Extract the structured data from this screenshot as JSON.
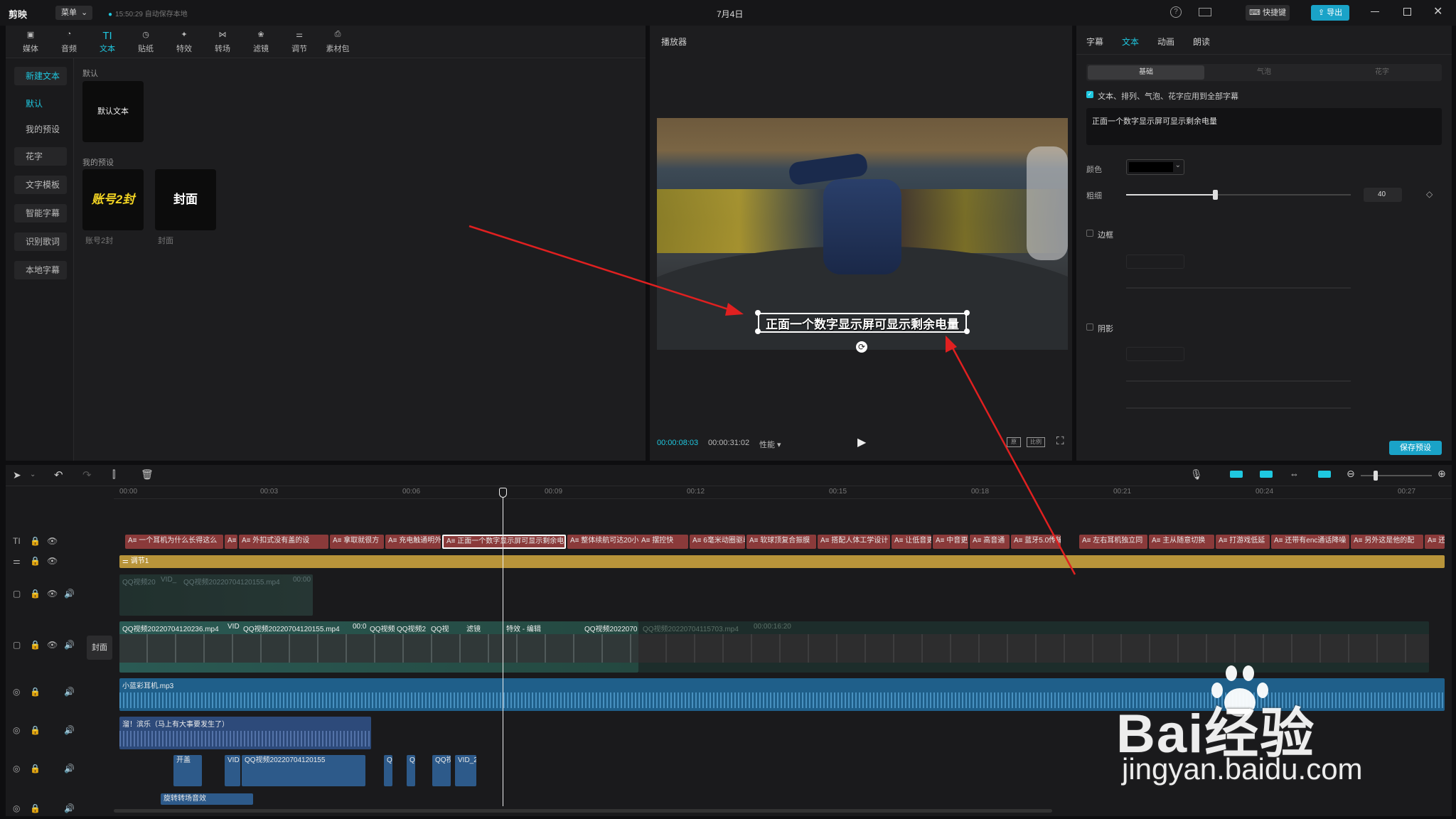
{
  "titlebar": {
    "app_name": "剪映",
    "menu_label": "菜单",
    "autosave": "15:50:29 自动保存本地",
    "project_title": "7月4日",
    "shortcut_label": "快捷键",
    "export_label": "导出"
  },
  "toolbar": [
    {
      "label": "媒体"
    },
    {
      "label": "音频"
    },
    {
      "label": "文本"
    },
    {
      "label": "贴纸"
    },
    {
      "label": "特效"
    },
    {
      "label": "转场"
    },
    {
      "label": "滤镜"
    },
    {
      "label": "调节"
    },
    {
      "label": "素材包"
    }
  ],
  "sidebar": [
    {
      "label": "新建文本"
    },
    {
      "label": "默认"
    },
    {
      "label": "我的预设"
    },
    {
      "label": "花字"
    },
    {
      "label": "文字模板"
    },
    {
      "label": "智能字幕"
    },
    {
      "label": "识别歌词"
    },
    {
      "label": "本地字幕"
    }
  ],
  "library": {
    "default_section": "默认",
    "default_card": "默认文本",
    "preset_section": "我的预设",
    "preset1_text": "账号2封",
    "preset1_caption": "账号2封",
    "preset2_text": "封面",
    "preset2_caption": "封面"
  },
  "player": {
    "title": "播放器",
    "subtitle": "正面一个数字显示屏可显示剩余电量",
    "current_time": "00:00:08:03",
    "total_time": "00:00:31:02",
    "mode": "性能",
    "btn_a": "原",
    "btn_b": "比例"
  },
  "inspector": {
    "tabs": [
      {
        "label": "字幕"
      },
      {
        "label": "文本"
      },
      {
        "label": "动画"
      },
      {
        "label": "朗读"
      }
    ],
    "subtabs": [
      {
        "label": "基础"
      },
      {
        "label": "气泡"
      },
      {
        "label": "花字"
      }
    ],
    "apply_all": "文本、排列、气泡、花字应用到全部字幕",
    "text_value": "正面一个数字显示屏可显示剩余电量",
    "color_label": "颜色",
    "size_label": "粗细",
    "size_value": "40",
    "border_label": "边框",
    "shadow_label": "阴影",
    "save_preset": "保存预设"
  },
  "timeline": {
    "ruler": [
      "00:00",
      "00:03",
      "00:06",
      "00:09",
      "00:12",
      "00:15",
      "00:18",
      "00:21",
      "00:24",
      "00:27"
    ],
    "cover_label": "封面",
    "text_clips": [
      "A≡ 一个耳机为什么长得这么",
      "A≡",
      "A≡ 外扣式没有盖的设",
      "A≡ 拿取就很方",
      "A≡ 充电触通明外",
      "A≡ 正面一个数字显示屏可显示剩余电",
      "A≡ 整体续航可达20小",
      "A≡ 摆控快",
      "A≡ 6毫米动圈驱动",
      "A≡ 软球顶复合振膜",
      "A≡ 搭配人体工学设计",
      "A≡ 让低音更",
      "A≡ 中音更",
      "A≡ 高音通",
      "A≡ 蓝牙5.0传输",
      "A≡ 左右耳机独立同",
      "A≡ 主从随意切换",
      "A≡ 打游戏低延",
      "A≡ 还带有enc通话降噪",
      "A≡ 另外这是他的配",
      "A≡ 还"
    ],
    "adjust_clip": "调节1",
    "overlay_clip_a": "QQ视频20",
    "overlay_clip_b": "VID_",
    "overlay_clip_c": "QQ视频20220704120155.mp4",
    "overlay_clip_d": "00:00",
    "main_clip_1": "QQ视频20220704120236.mp4",
    "main_clip_2": "VID",
    "main_clip_3": "QQ视频20220704120155.mp4",
    "main_clip_4": "00:0",
    "main_clip_5": "QQ视频",
    "main_clip_6": "QQ视频2",
    "main_clip_7": "QQ视",
    "main_clip_8": "滤镜",
    "main_clip_9": "特效 - 编辑",
    "main_clip_10": "QQ视频2022070",
    "main_clip_ghost": "QQ视频20220704115703.mp4",
    "main_clip_ghost_time": "00:00:16:20",
    "audio1": "小蓝彩耳机.mp3",
    "audio2": "溜！滨乐（马上有大事要发生了）",
    "sfx1": "开盖",
    "sfx2": "VID",
    "sfx3": "QQ视频20220704120155",
    "sfx4": "Q",
    "sfx5": "Q",
    "sfx6": "QQ视",
    "sfx7": "VID_2",
    "sfx8": "旋转转场音效"
  },
  "watermark": {
    "brand": "Bai经验",
    "url": "jingyan.baidu.com"
  },
  "colors": {
    "accent": "#1fc8e0",
    "text_clip": "#8a3a3a",
    "adjust": "#b8943a",
    "audio": "#1f5f8a",
    "export": "#1aa3c8"
  }
}
